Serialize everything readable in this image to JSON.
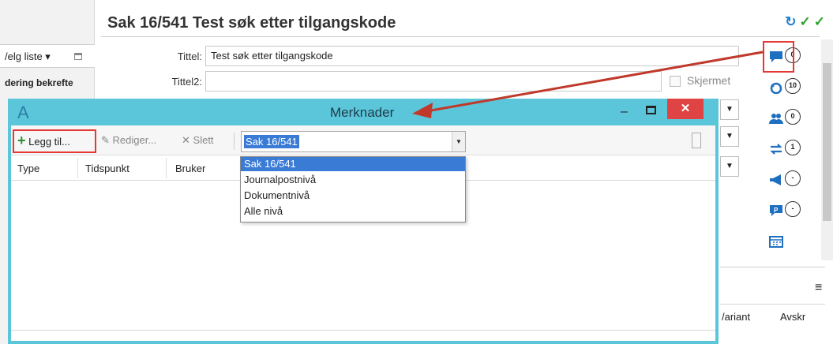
{
  "left_panel": {
    "list_select_label": "/elg liste ▾",
    "row_text": "dering bekrefte"
  },
  "case": {
    "title": "Sak 16/541 Test søk etter tilgangskode",
    "fields": {
      "tittel_label": "Tittel:",
      "tittel_value": "Test søk etter tilgangskode",
      "tittel2_label": "Tittel2:",
      "tittel2_value": "",
      "skjermet_label": "Skjermet"
    }
  },
  "header_icons": {
    "refresh": "↻",
    "check1": "✓",
    "check2": "✓"
  },
  "right_toolbar": [
    {
      "icon": "comment-icon",
      "badge": "0"
    },
    {
      "icon": "history-icon",
      "badge": "10"
    },
    {
      "icon": "users-icon",
      "badge": "0"
    },
    {
      "icon": "transfer-icon",
      "badge": "1"
    },
    {
      "icon": "megaphone-icon",
      "badge": "-"
    },
    {
      "icon": "parking-icon",
      "badge": "-"
    },
    {
      "icon": "calendar-icon",
      "badge": ""
    }
  ],
  "background_table": {
    "col_variant": "/ariant",
    "col_avskr": "Avskr"
  },
  "dialog": {
    "logo": "A",
    "title": "Merknader",
    "minimize": "–",
    "close": "✕",
    "toolbar": {
      "add_label": "Legg til...",
      "edit_label": "Rediger...",
      "delete_label": "Slett"
    },
    "level_select": {
      "value": "Sak 16/541",
      "options": [
        "Sak 16/541",
        "Journalpostnivå",
        "Dokumentnivå",
        "Alle nivå"
      ]
    },
    "columns": [
      "Type",
      "Tidspunkt",
      "Bruker"
    ]
  },
  "colors": {
    "dialog_accent": "#5bc6d9",
    "highlight_red": "#e53935",
    "selection_blue": "#3a7bd5",
    "arrow_color": "#c0392b"
  }
}
